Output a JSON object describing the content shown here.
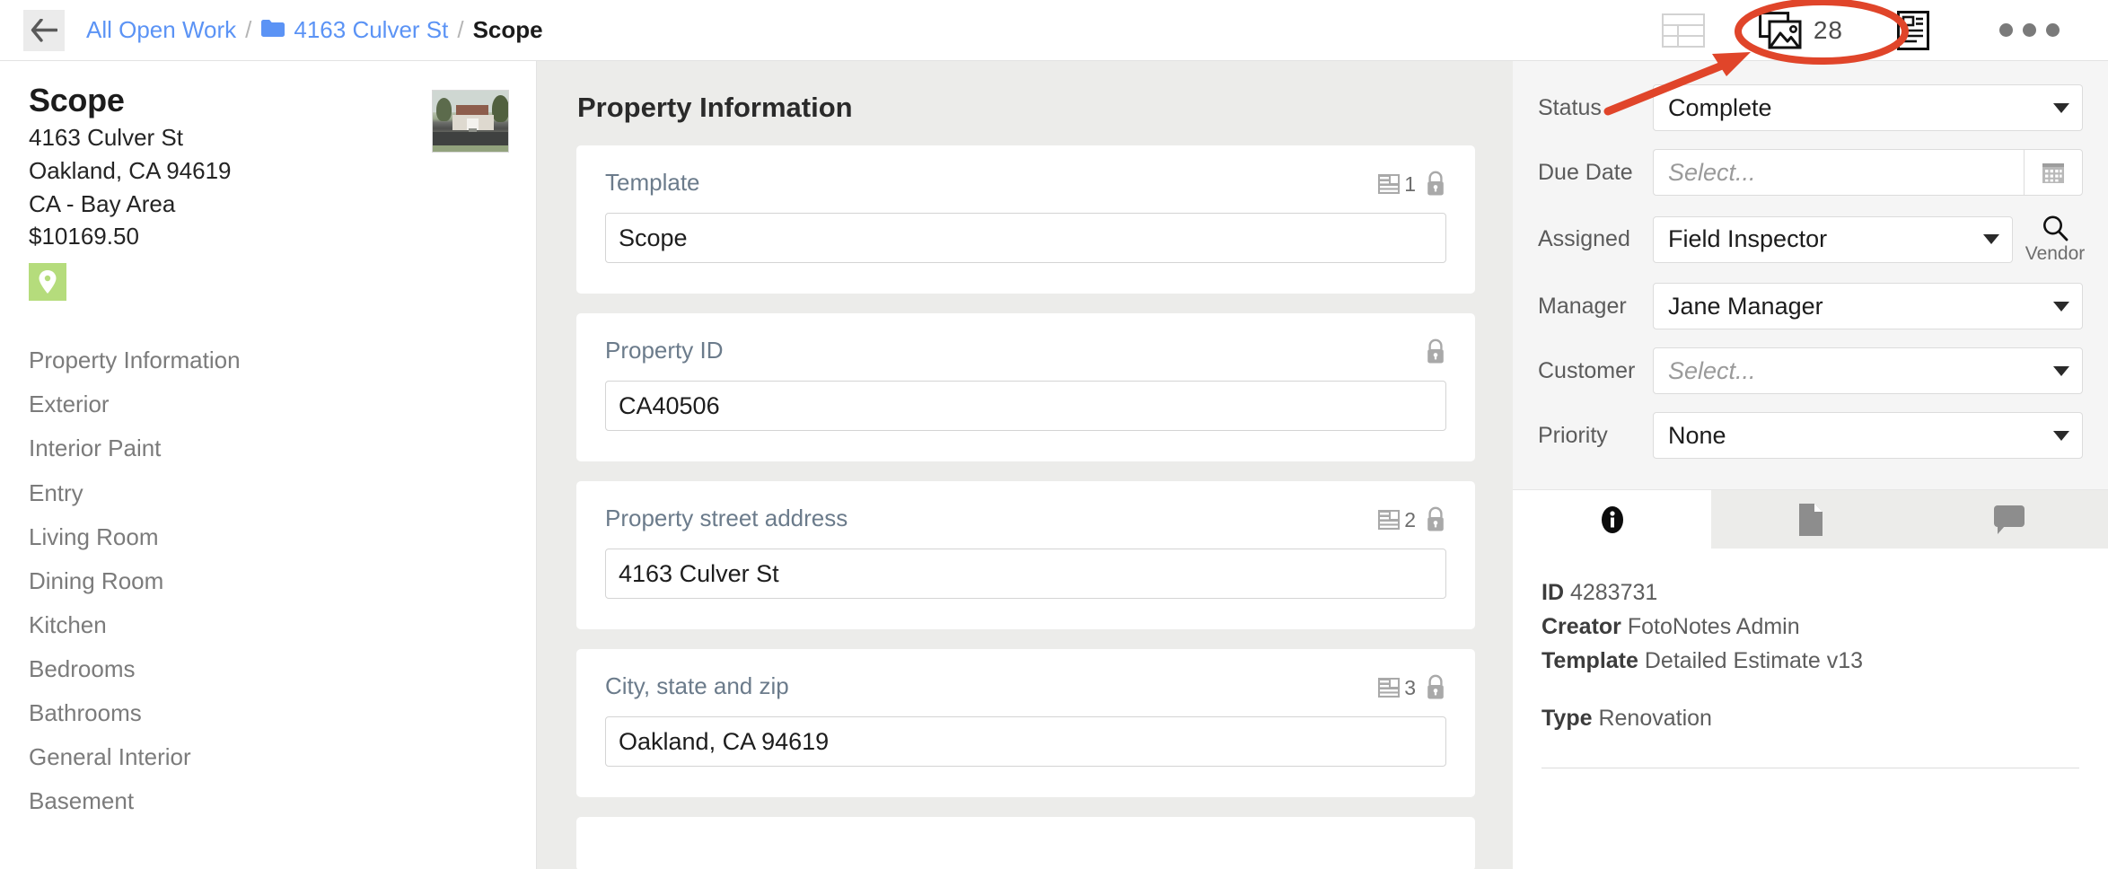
{
  "breadcrumb": {
    "back_icon": "arrow-left-icon",
    "root": "All Open Work",
    "sep": "/",
    "folder_icon": "folder-icon",
    "folder": "4163 Culver St",
    "current": "Scope"
  },
  "toolbar": {
    "grid_icon": "table-grid-icon",
    "photos_icon": "photos-icon",
    "photo_count": "28",
    "report_icon": "report-card-icon",
    "more_icon": "more-dots-icon"
  },
  "sidebar": {
    "title": "Scope",
    "address1": "4163 Culver St",
    "address2": "Oakland, CA 94619",
    "region": "CA - Bay Area",
    "amount": "$10169.50",
    "map_icon": "map-pin-icon",
    "thumbnail_alt": "property-photo",
    "nav": [
      "Property Information",
      "Exterior",
      "Interior Paint",
      "Entry",
      "Living Room",
      "Dining Room",
      "Kitchen",
      "Bedrooms",
      "Bathrooms",
      "General Interior",
      "Basement"
    ]
  },
  "main": {
    "section_title": "Property Information",
    "fields": [
      {
        "label": "Template",
        "value": "Scope",
        "note_count": "1",
        "locked": true
      },
      {
        "label": "Property ID",
        "value": "CA40506",
        "note_count": "",
        "locked": true
      },
      {
        "label": "Property street address",
        "value": "4163 Culver St",
        "note_count": "2",
        "locked": true
      },
      {
        "label": "City, state and zip",
        "value": "Oakland, CA 94619",
        "note_count": "3",
        "locked": true
      }
    ]
  },
  "right": {
    "rows": [
      {
        "label": "Status",
        "value": "Complete",
        "placeholder": false,
        "control": "select"
      },
      {
        "label": "Due Date",
        "value": "Select...",
        "placeholder": true,
        "control": "date"
      },
      {
        "label": "Assigned",
        "value": "Field Inspector",
        "placeholder": false,
        "control": "select"
      },
      {
        "label": "Manager",
        "value": "Jane Manager",
        "placeholder": false,
        "control": "select"
      },
      {
        "label": "Customer",
        "value": "Select...",
        "placeholder": true,
        "control": "select"
      },
      {
        "label": "Priority",
        "value": "None",
        "placeholder": false,
        "control": "select"
      }
    ],
    "vendor_label": "Vendor",
    "vendor_icon": "search-icon",
    "tabs": [
      {
        "icon": "info-icon",
        "active": true
      },
      {
        "icon": "document-icon",
        "active": false
      },
      {
        "icon": "comment-icon",
        "active": false
      }
    ],
    "info": {
      "id_label": "ID",
      "id_value": "4283731",
      "creator_label": "Creator",
      "creator_value": "FotoNotes Admin",
      "template_label": "Template",
      "template_value": "Detailed Estimate v13",
      "type_label": "Type",
      "type_value": "Renovation"
    }
  },
  "annotation": {
    "color": "#e0452a",
    "shapes": "ellipse-highlight-and-arrow",
    "target": "photos-icon"
  }
}
